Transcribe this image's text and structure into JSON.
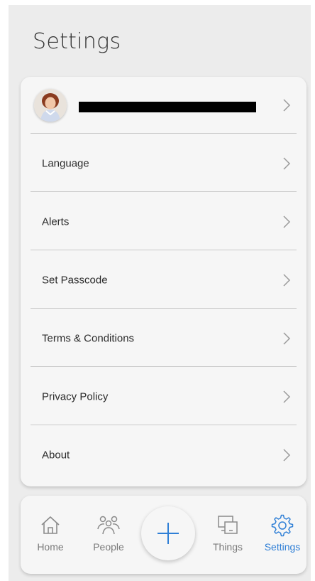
{
  "header": {
    "title": "Settings"
  },
  "profile": {
    "name_redacted": true,
    "avatar_icon": "avatar-portrait"
  },
  "menu": {
    "items": [
      {
        "label": "Language"
      },
      {
        "label": "Alerts"
      },
      {
        "label": "Set Passcode"
      },
      {
        "label": "Terms & Conditions"
      },
      {
        "label": "Privacy Policy"
      },
      {
        "label": "About"
      }
    ]
  },
  "nav": {
    "home_label": "Home",
    "people_label": "People",
    "things_label": "Things",
    "settings_label": "Settings",
    "add_icon": "plus-icon",
    "active": "Settings"
  },
  "colors": {
    "accent": "#2f7fd6",
    "background": "#ececec",
    "card": "#f6f6f6"
  }
}
